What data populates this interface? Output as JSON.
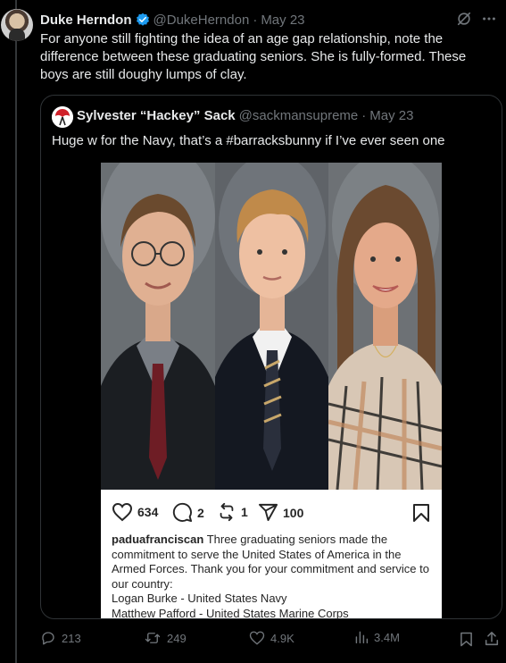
{
  "tweet": {
    "author_name": "Duke Herndon",
    "handle": "@DukeHerndon",
    "separator": "·",
    "date": "May 23",
    "text": "For anyone still fighting the idea of an age gap relationship, note the difference between these graduating seniors. She is fully-formed. These boys are still doughy lumps of clay.",
    "verified_color": "#1d9bf0"
  },
  "quoted": {
    "author_name": "Sylvester “Hackey” Sack",
    "handle": "@sackmansupreme",
    "separator": "·",
    "date": "May 23",
    "text": "Huge w for the Navy, that’s a #barracksbunny if I’ve ever seen one"
  },
  "instagram": {
    "likes": "634",
    "comments": "2",
    "reposts": "1",
    "shares": "100",
    "caption_user": "paduafranciscan",
    "caption_text": " Three graduating seniors made the commitment to serve the United States of America in the Armed Forces. Thank you for your commitment and service to our country:",
    "caption_line1": "Logan Burke - United States Navy",
    "caption_line2": "Matthew Pafford - United States Marine Corps"
  },
  "actions": {
    "replies": "213",
    "reposts": "249",
    "likes": "4.9K",
    "views": "3.4M"
  },
  "colors": {
    "accent": "#1d9bf0",
    "muted": "#71767b",
    "text": "#e7e9ea",
    "border": "#2f3336"
  },
  "icons": [
    "grok-icon",
    "more-icon",
    "verified-badge-icon",
    "reply-icon",
    "repost-icon",
    "like-icon",
    "views-icon",
    "bookmark-icon",
    "share-icon",
    "heart-icon",
    "comment-icon",
    "send-icon"
  ]
}
